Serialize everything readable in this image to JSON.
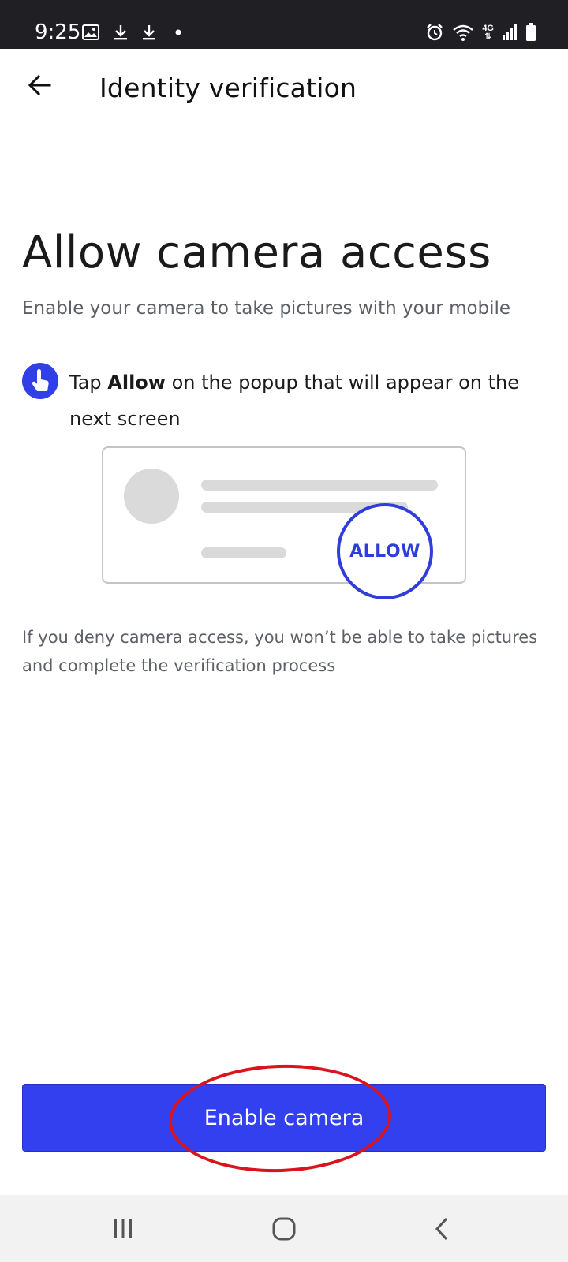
{
  "status_bar": {
    "time": "9:25",
    "left_icons": [
      "gallery-icon",
      "download-icon",
      "download-icon",
      "dot-icon"
    ],
    "right_icons": [
      "alarm-icon",
      "wifi-icon",
      "network-4g-icon",
      "signal-icon",
      "battery-icon"
    ],
    "network_label": "4G"
  },
  "app_bar": {
    "back_icon": "arrow-left-icon",
    "title": "Identity verification"
  },
  "content": {
    "heading": "Allow camera access",
    "subheading": "Enable your camera to take pictures with your mobile",
    "tip": {
      "icon": "hand-tap-icon",
      "prefix": "Tap ",
      "emphasis": "Allow",
      "suffix": " on the popup that will appear on the next screen"
    },
    "illustration": {
      "allow_label": "ALLOW"
    },
    "warning": "If you deny camera access, you won’t be able to take pictures and complete the verification process"
  },
  "primary_action": {
    "label": "Enable camera"
  },
  "nav_bar": {
    "items": [
      "recents-icon",
      "home-icon",
      "back-icon"
    ]
  },
  "colors": {
    "accent": "#3340f0",
    "highlight": "#d9141c",
    "status_bar_bg": "#1f1f24",
    "nav_bar_bg": "#f2f2f2"
  }
}
